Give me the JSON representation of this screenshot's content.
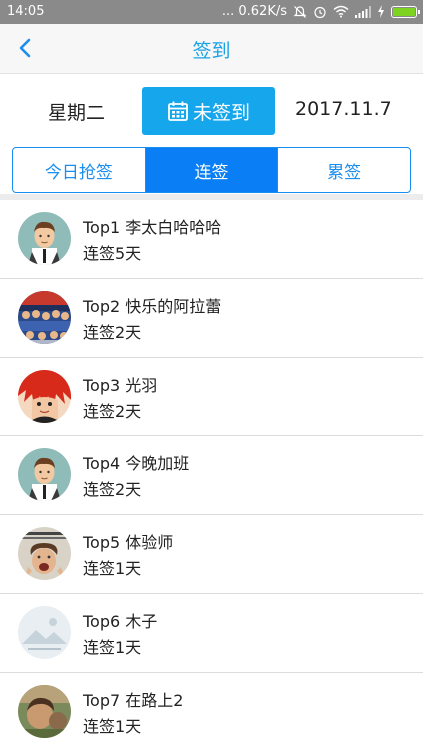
{
  "status_bar": {
    "time": "14:05",
    "speed": "... 0.62K/s",
    "battery_level": 1.0,
    "icons": [
      "mute-icon",
      "alarm-icon",
      "wifi-icon",
      "signal-icon",
      "charging-icon",
      "battery-icon"
    ]
  },
  "nav": {
    "title": "签到",
    "back_icon": "chevron-left-icon"
  },
  "header": {
    "weekday": "星期二",
    "checkin_label": "未签到",
    "date": "2017.11.7"
  },
  "tabs": [
    {
      "label": "今日抢签",
      "active": false
    },
    {
      "label": "连签",
      "active": true
    },
    {
      "label": "累签",
      "active": false
    }
  ],
  "colors": {
    "accent": "#1a8ef0",
    "button": "#16a6ec",
    "status_bar": "#8a8a8a",
    "battery": "#7ed321"
  },
  "ranking": [
    {
      "rank": "Top1",
      "name": "李太白哈哈哈",
      "days": "连签5天",
      "avatar": "cartoon-man"
    },
    {
      "rank": "Top2",
      "name": "快乐的阿拉蕾",
      "days": "连签2天",
      "avatar": "crowd-photo"
    },
    {
      "rank": "Top3",
      "name": "光羽",
      "days": "连签2天",
      "avatar": "red-anime"
    },
    {
      "rank": "Top4",
      "name": "今晚加班",
      "days": "连签2天",
      "avatar": "cartoon-man"
    },
    {
      "rank": "Top5",
      "name": "体验师",
      "days": "连签1天",
      "avatar": "screaming-photo"
    },
    {
      "rank": "Top6",
      "name": "木子",
      "days": "连签1天",
      "avatar": "placeholder-landscape"
    },
    {
      "rank": "Top7",
      "name": "在路上2",
      "days": "连签1天",
      "avatar": "outdoor-photo"
    }
  ]
}
